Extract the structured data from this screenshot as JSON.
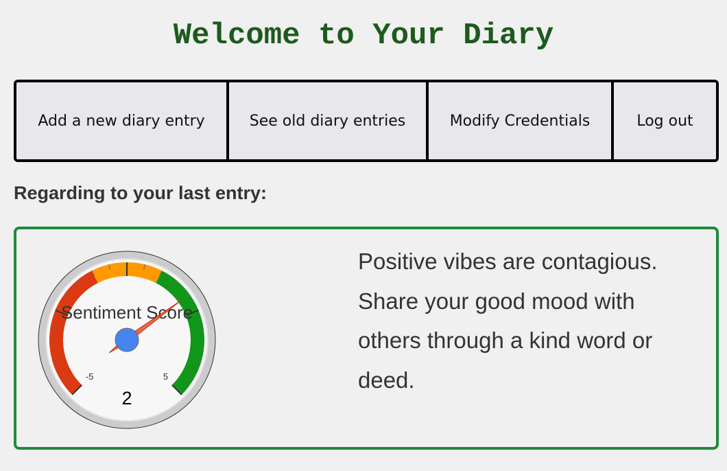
{
  "header": {
    "title": "Welcome to Your Diary"
  },
  "nav": {
    "add_entry": "Add a new diary entry",
    "old_entries": "See old diary entries",
    "modify_credentials": "Modify Credentials",
    "log_out": "Log out"
  },
  "main": {
    "section_heading": "Regarding to your last entry:",
    "gauge": {
      "label": "Sentiment Score",
      "value": 2,
      "display_value": "2",
      "min": -5,
      "max": 5,
      "min_label": "-5",
      "max_label": "5",
      "colors": {
        "low": "#dc3912",
        "mid": "#ff9900",
        "high": "#109618",
        "needle": "#dc3912",
        "hub": "#4684ee"
      }
    },
    "message": "Positive vibes are contagious. Share your good mood with others through a kind word or deed."
  },
  "colors": {
    "title": "#1d5a1d",
    "card_border": "#1e8a3c"
  }
}
